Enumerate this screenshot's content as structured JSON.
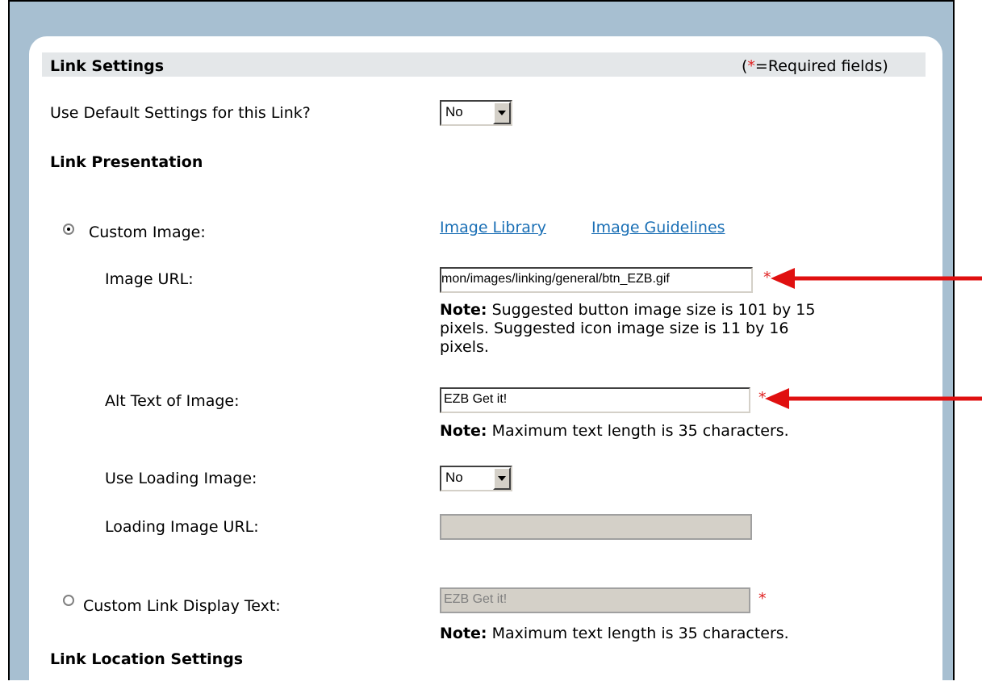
{
  "section": {
    "title": "Link Settings",
    "required_note": {
      "prefix": "(",
      "asterisk": "*",
      "suffix": "=Required fields)"
    }
  },
  "use_default": {
    "label": "Use Default Settings for this Link?",
    "value": "No"
  },
  "presentation": {
    "heading": "Link Presentation"
  },
  "custom_image": {
    "label": "Custom Image:",
    "selected": true,
    "links": [
      "Image Library",
      "Image Guidelines"
    ],
    "image_url": {
      "label": "Image URL:",
      "value": "mon/images/linking/general/btn_EZB.gif",
      "required": "*",
      "note_bold": "Note:",
      "note_text": " Suggested button image size is 101 by 15",
      "note_line2": "pixels. Suggested icon image size is 11 by 16",
      "note_line3": "pixels."
    },
    "alt_text": {
      "label": "Alt Text of Image:",
      "value": "EZB Get it!",
      "required": "*",
      "note_bold": "Note:",
      "note_text": " Maximum text length is 35 characters."
    },
    "use_loading": {
      "label": "Use Loading Image:",
      "value": "No"
    },
    "loading_url": {
      "label": "Loading Image URL:",
      "value": ""
    }
  },
  "custom_text": {
    "label": "Custom Link Display Text:",
    "selected": false,
    "value": "EZB Get it!",
    "required": "*",
    "note_bold": "Note:",
    "note_text": " Maximum text length is 35 characters."
  },
  "location": {
    "heading": "Link Location Settings"
  },
  "colors": {
    "arrow": "#e01010",
    "link": "#1a6fb5",
    "frame": "#a7bfd1"
  }
}
